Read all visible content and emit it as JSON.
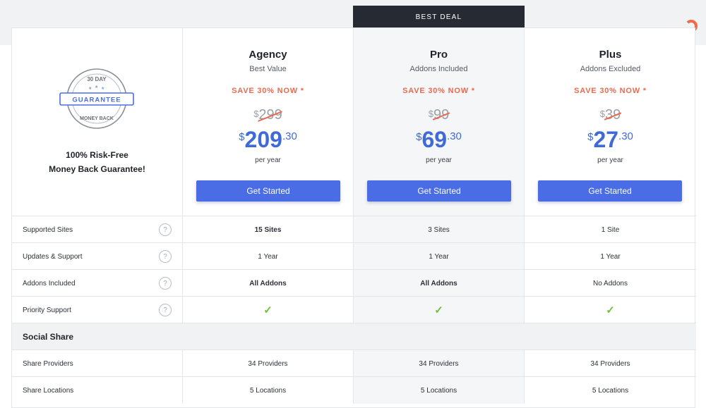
{
  "banner": {
    "label": "BEST DEAL"
  },
  "guarantee": {
    "badge_top": "30 DAY",
    "badge_center": "GUARANTEE",
    "badge_bottom": "MONEY BACK",
    "line1": "100% Risk-Free",
    "line2": "Money Back Guarantee!"
  },
  "plans": [
    {
      "name": "Agency",
      "subtitle": "Best Value",
      "save": "SAVE 30% NOW *",
      "currency": "$",
      "old_price": "299",
      "new_price": "209",
      "cents": ".30",
      "period": "per year",
      "cta": "Get Started"
    },
    {
      "name": "Pro",
      "subtitle": "Addons Included",
      "save": "SAVE 30% NOW *",
      "currency": "$",
      "old_price": "99",
      "new_price": "69",
      "cents": ".30",
      "period": "per year",
      "cta": "Get Started"
    },
    {
      "name": "Plus",
      "subtitle": "Addons Excluded",
      "save": "SAVE 30% NOW *",
      "currency": "$",
      "old_price": "39",
      "new_price": "27",
      "cents": ".30",
      "period": "per year",
      "cta": "Get Started"
    }
  ],
  "help_icon": "?",
  "features": [
    {
      "label": "Supported Sites",
      "values": [
        "15 Sites",
        "3 Sites",
        "1 Site"
      ]
    },
    {
      "label": "Updates & Support",
      "values": [
        "1 Year",
        "1 Year",
        "1 Year"
      ]
    },
    {
      "label": "Addons Included",
      "values": [
        "All Addons",
        "All Addons",
        "No Addons"
      ]
    },
    {
      "label": "Priority Support",
      "values": [
        "✓",
        "✓",
        "✓"
      ]
    }
  ],
  "section": {
    "title": "Social Share"
  },
  "social": [
    {
      "label": "Share Providers",
      "values": [
        "34 Providers",
        "34 Providers",
        "34 Providers"
      ]
    },
    {
      "label": "Share Locations",
      "values": [
        "5 Locations",
        "5 Locations",
        "5 Locations"
      ]
    }
  ],
  "colors": {
    "accent": "#4a6de5",
    "price": "#3f6ad8",
    "save": "#e86b50",
    "check": "#6ec23a",
    "banner": "#262a33"
  }
}
